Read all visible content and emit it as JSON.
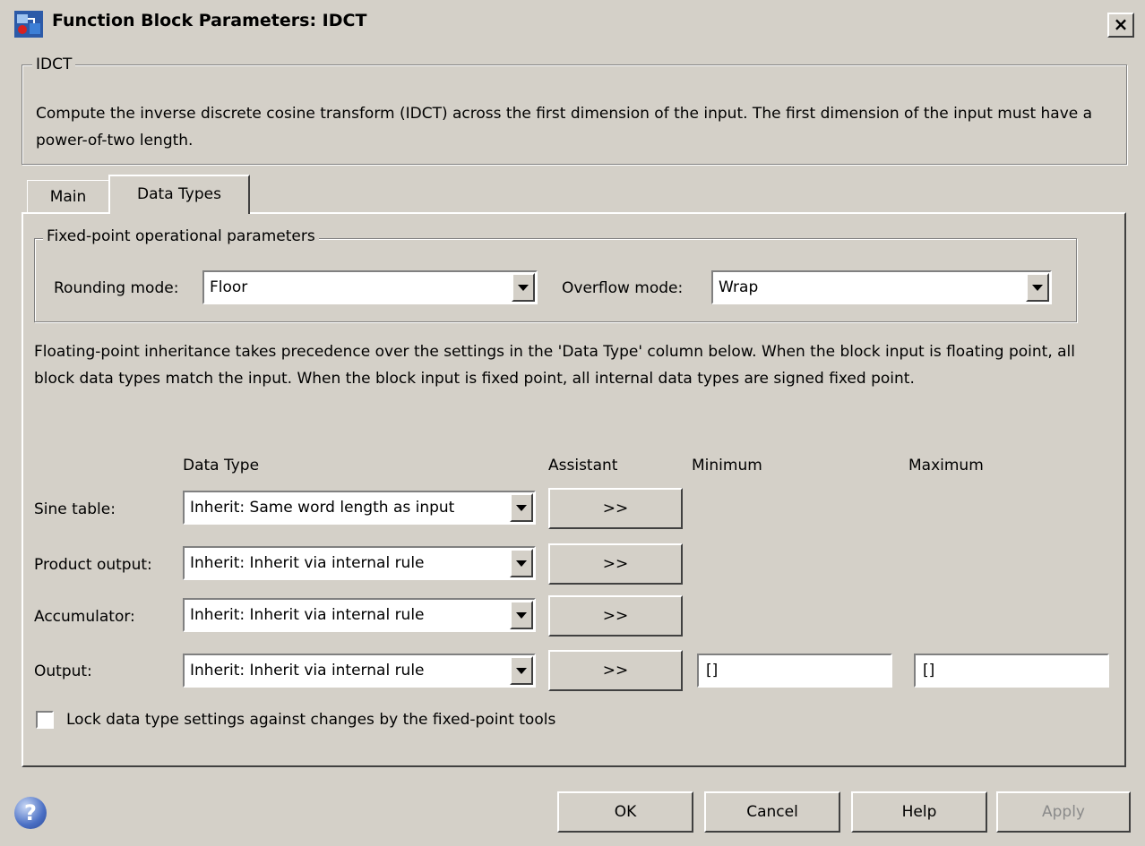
{
  "window": {
    "title": "Function Block Parameters: IDCT",
    "close_glyph": "×"
  },
  "description": {
    "group_title": "IDCT",
    "text": "Compute the inverse discrete cosine transform (IDCT) across the first dimension of the input. The first dimension of the input must have a power-of-two length."
  },
  "tabs": [
    {
      "label": "Main",
      "active": false
    },
    {
      "label": "Data Types",
      "active": true
    }
  ],
  "fixed_point": {
    "group_title": "Fixed-point operational parameters",
    "rounding_label": "Rounding mode:",
    "rounding_value": "Floor",
    "overflow_label": "Overflow mode:",
    "overflow_value": "Wrap"
  },
  "inheritance_note": "Floating-point inheritance takes precedence over the settings in the 'Data Type' column below. When the block input is floating point, all block data types match the input. When the block input is fixed point, all internal data types are signed fixed point.",
  "table": {
    "headers": {
      "data_type": "Data Type",
      "assistant": "Assistant",
      "minimum": "Minimum",
      "maximum": "Maximum"
    },
    "rows": [
      {
        "label": "Sine table:",
        "data_type": "Inherit: Same word length as input",
        "assistant": ">>"
      },
      {
        "label": "Product output:",
        "data_type": "Inherit: Inherit via internal rule",
        "assistant": ">>"
      },
      {
        "label": "Accumulator:",
        "data_type": "Inherit: Inherit via internal rule",
        "assistant": ">>"
      },
      {
        "label": "Output:",
        "data_type": "Inherit: Inherit via internal rule",
        "assistant": ">>",
        "minimum": "[]",
        "maximum": "[]"
      }
    ]
  },
  "lock_checkbox": {
    "label": "Lock data type settings against changes by the fixed-point tools",
    "checked": false
  },
  "footer": {
    "help_icon": "?",
    "ok": "OK",
    "cancel": "Cancel",
    "help": "Help",
    "apply": "Apply",
    "apply_enabled": false
  }
}
